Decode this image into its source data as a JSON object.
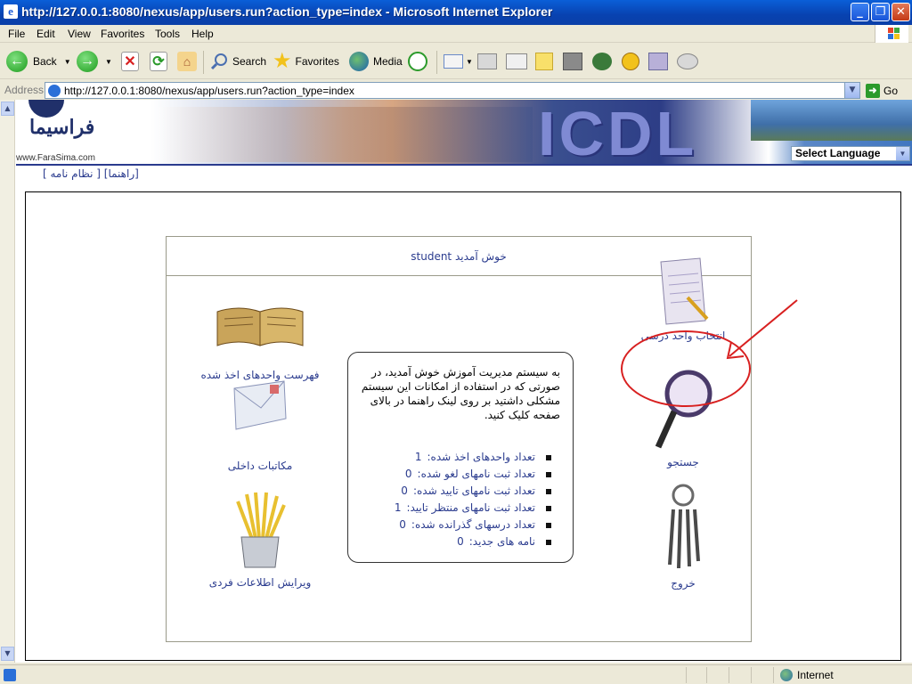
{
  "window": {
    "title": "http://127.0.0.1:8080/nexus/app/users.run?action_type=index - Microsoft Internet Explorer"
  },
  "menu": [
    "File",
    "Edit",
    "View",
    "Favorites",
    "Tools",
    "Help"
  ],
  "toolbar": {
    "back": "Back",
    "search": "Search",
    "favorites": "Favorites",
    "media": "Media"
  },
  "address": {
    "label": "Address",
    "url": "http://127.0.0.1:8080/nexus/app/users.run?action_type=index",
    "go": "Go"
  },
  "banner": {
    "logo_text": "فراسیما",
    "logo_url": "www.FaraSima.com",
    "product": "ICDL",
    "language_select": "Select Language"
  },
  "help_links": {
    "help": "[راهنما]",
    "rules": "[ نظام نامه ]"
  },
  "panel": {
    "welcome": "خوش آمدید student",
    "items": {
      "courses_taken": "فهرست واحدهای اخذ شده",
      "course_selection": "انتخاب واحد درسی",
      "messages": "مکاتبات داخلی",
      "search": "جستجو",
      "edit_profile": "ویرایش اطلاعات فردی",
      "logout": "خروج"
    },
    "info": {
      "intro": "به سیستم مدیریت آموزش خوش آمدید، در صورتی که در استفاده از امکانات این سیستم مشکلی داشتید بر روی لینک راهنما در بالای صفحه کلیک کنید.",
      "stats": [
        {
          "label": "تعداد واحدهای اخذ شده:",
          "value": "1"
        },
        {
          "label": "تعداد ثبت نامهای لغو شده:",
          "value": "0"
        },
        {
          "label": "تعداد ثبت نامهای تایید شده:",
          "value": "0"
        },
        {
          "label": "تعداد ثبت نامهای منتظر تایید:",
          "value": "1"
        },
        {
          "label": "تعداد درسهای گذرانده شده:",
          "value": "0"
        },
        {
          "label": "نامه های جدید:",
          "value": "0"
        }
      ]
    }
  },
  "status": {
    "zone": "Internet"
  },
  "colors": {
    "link": "#2a3b8e",
    "annotation": "#d82020"
  }
}
